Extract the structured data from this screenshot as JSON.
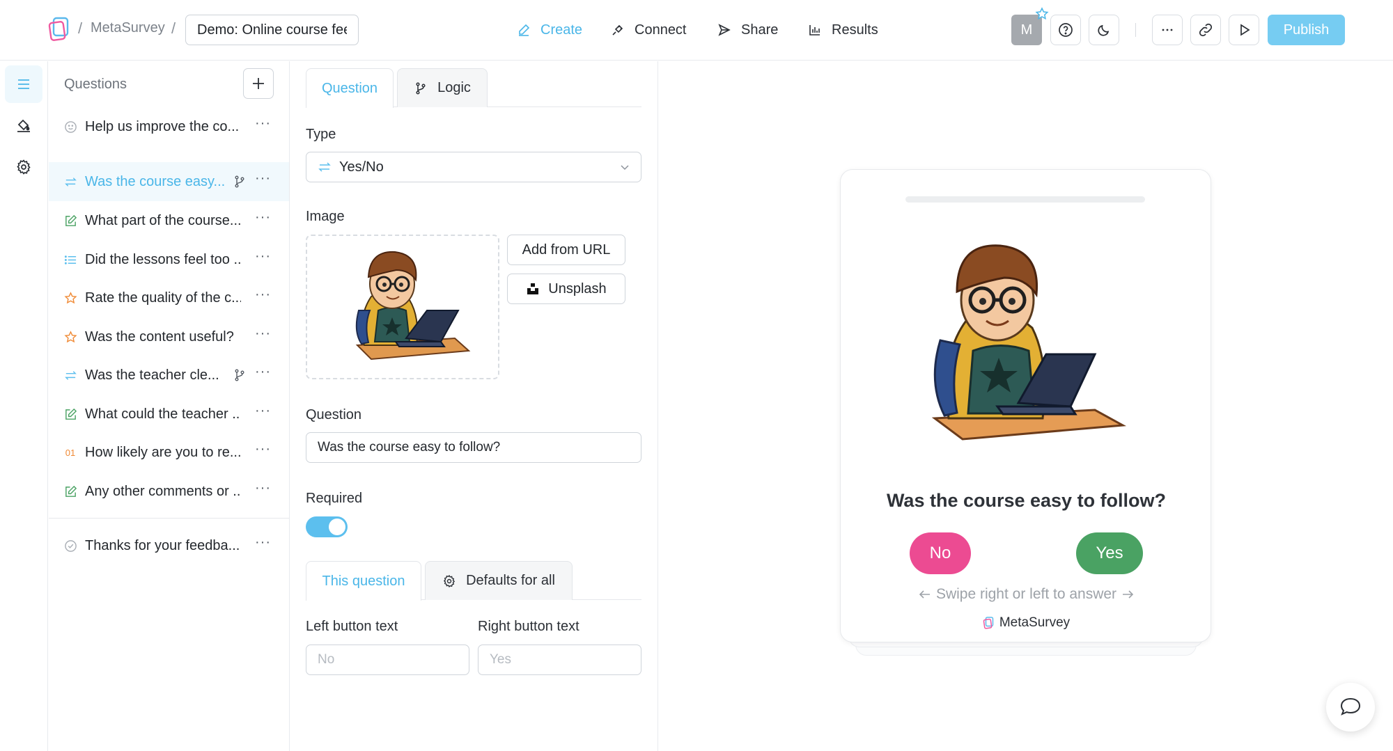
{
  "header": {
    "app_name": "MetaSurvey",
    "survey_name": "Demo: Online course feedback",
    "nav": [
      {
        "label": "Create",
        "icon": "pencil-icon",
        "active": true
      },
      {
        "label": "Connect",
        "icon": "plug-icon"
      },
      {
        "label": "Share",
        "icon": "send-icon"
      },
      {
        "label": "Results",
        "icon": "bar-chart-icon"
      }
    ],
    "avatar_initial": "M",
    "publish_label": "Publish",
    "accent_color": "#4ab6e8"
  },
  "sidebar": {
    "title": "Questions",
    "items": [
      {
        "text": "Help us improve the co...",
        "icon": "smile-icon"
      },
      {
        "text": "Was the course easy...",
        "icon": "arrows-icon",
        "active": true,
        "has_logic": true
      },
      {
        "text": "What part of the course...",
        "icon": "edit-icon"
      },
      {
        "text": "Did the lessons feel too ...",
        "icon": "list-icon"
      },
      {
        "text": "Rate the quality of the c...",
        "icon": "star-icon"
      },
      {
        "text": "Was the content useful?",
        "icon": "star-icon"
      },
      {
        "text": "Was the teacher cle...",
        "icon": "arrows-icon",
        "has_logic": true
      },
      {
        "text": "What could the teacher ...",
        "icon": "edit-icon"
      },
      {
        "text": "How likely are you to re...",
        "icon": "nps-icon",
        "badge": "01"
      },
      {
        "text": "Any other comments or ...",
        "icon": "edit-icon"
      },
      {
        "text": "Thanks for your feedba...",
        "icon": "check-circle-icon"
      }
    ]
  },
  "editor": {
    "tabs": {
      "question": "Question",
      "logic": "Logic"
    },
    "type_label": "Type",
    "type_value": "Yes/No",
    "image_label": "Image",
    "add_from_url": "Add from URL",
    "unsplash": "Unsplash",
    "question_label": "Question",
    "question_value": "Was the course easy to follow?",
    "required_label": "Required",
    "required": true,
    "sub_tabs": {
      "this_question": "This question",
      "defaults": "Defaults for all"
    },
    "left_button_label": "Left button text",
    "right_button_label": "Right button text",
    "left_placeholder": "No",
    "right_placeholder": "Yes"
  },
  "preview": {
    "question": "Was the course easy to follow?",
    "no_label": "No",
    "yes_label": "Yes",
    "no_color": "#ec4b92",
    "yes_color": "#4aa263",
    "swipe_hint": "Swipe right or left to answer",
    "brand": "MetaSurvey"
  }
}
